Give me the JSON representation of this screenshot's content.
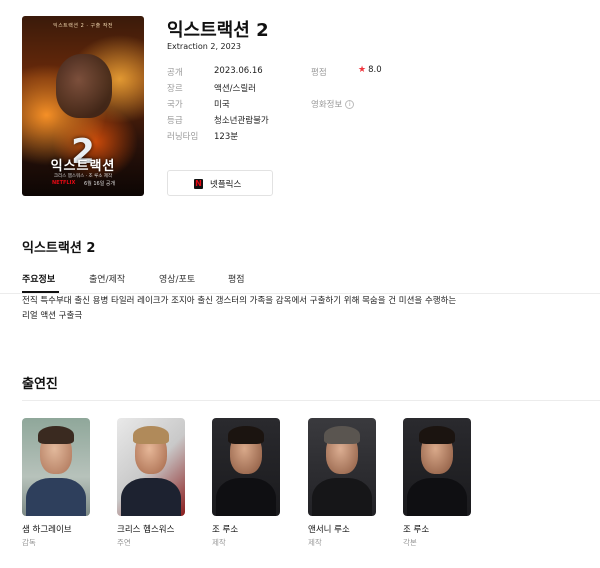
{
  "movie": {
    "title": "익스트랙션 2",
    "subtitle": "Extraction 2, 2023"
  },
  "poster": {
    "tagline": "익스트랙션 2 · 구출 작전",
    "number": "2",
    "title_text": "익스트랙션",
    "sub_text": "크리스 헴스워스 · 조 루소 제작",
    "netflix_text": "NETFLIX",
    "date_text": "6월 16일 공개"
  },
  "meta": {
    "release_label": "공개",
    "release_value": "2023.06.16",
    "genre_label": "장르",
    "genre_value": "액션/스릴러",
    "country_label": "국가",
    "country_value": "미국",
    "rating_label": "등급",
    "rating_value": "청소년관람불가",
    "runtime_label": "러닝타임",
    "runtime_value": "123분",
    "score_label": "평점",
    "score_value": "8.0",
    "movieinfo_label": "영화정보"
  },
  "watch": {
    "netflix_label": "넷플릭스"
  },
  "section": {
    "title": "익스트랙션 2"
  },
  "tabs": [
    {
      "label": "주요정보"
    },
    {
      "label": "출연/제작"
    },
    {
      "label": "영상/포토"
    },
    {
      "label": "평점"
    }
  ],
  "synopsis": {
    "line1": "전직 특수부대 출신 용병 타일러 레이크가 조지아 출신 갱스터의 가족을 감옥에서 구출하기 위해 목숨을 건 미션을 수행하는",
    "line2": "리얼 액션 구출극"
  },
  "cast": {
    "title": "출연진",
    "members": [
      {
        "name": "샘 하그레이브",
        "role": "감독"
      },
      {
        "name": "크리스 헴스워스",
        "role": "주연"
      },
      {
        "name": "조 루소",
        "role": "제작"
      },
      {
        "name": "앤서니 루소",
        "role": "제작"
      },
      {
        "name": "조 루소",
        "role": "각본"
      }
    ]
  },
  "colors": {
    "accent_star": "#f0343c",
    "netflix_red": "#e50914",
    "text_main": "#111111",
    "text_muted": "#999999"
  }
}
